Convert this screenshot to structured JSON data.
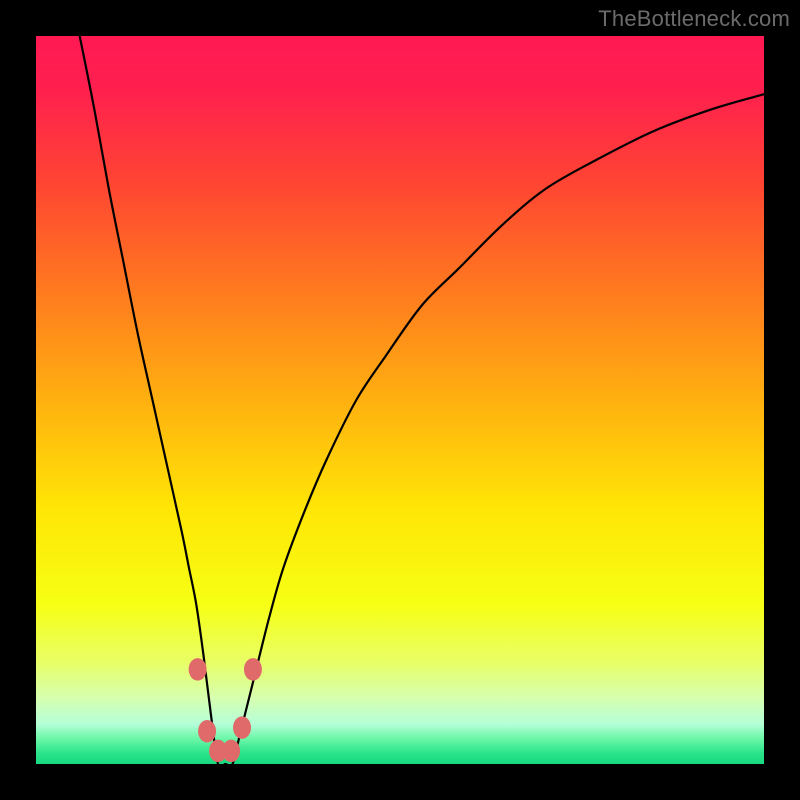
{
  "watermark": "TheBottleneck.com",
  "chart_data": {
    "type": "line",
    "title": "",
    "xlabel": "",
    "ylabel": "",
    "xlim": [
      0,
      100
    ],
    "ylim": [
      0,
      100
    ],
    "background_gradient": {
      "direction": "vertical",
      "stops": [
        {
          "pos": 0.0,
          "color": "#ff1a53"
        },
        {
          "pos": 0.07,
          "color": "#ff1f4f"
        },
        {
          "pos": 0.2,
          "color": "#ff4433"
        },
        {
          "pos": 0.35,
          "color": "#ff7a1f"
        },
        {
          "pos": 0.5,
          "color": "#ffb010"
        },
        {
          "pos": 0.65,
          "color": "#ffe605"
        },
        {
          "pos": 0.78,
          "color": "#f6ff14"
        },
        {
          "pos": 0.86,
          "color": "#e8ff66"
        },
        {
          "pos": 0.91,
          "color": "#d6ffb0"
        },
        {
          "pos": 0.945,
          "color": "#b5ffd8"
        },
        {
          "pos": 0.965,
          "color": "#6cf7a8"
        },
        {
          "pos": 0.985,
          "color": "#2be48b"
        },
        {
          "pos": 1.0,
          "color": "#17d97f"
        }
      ]
    },
    "series": [
      {
        "name": "bottleneck-curve",
        "color": "#000000",
        "x": [
          6,
          8,
          10,
          12,
          14,
          16,
          18,
          20,
          21,
          22,
          23,
          24,
          25,
          26,
          27,
          28,
          30,
          32,
          34,
          37,
          40,
          44,
          48,
          53,
          58,
          64,
          70,
          77,
          85,
          93,
          100
        ],
        "y": [
          100,
          90,
          79,
          69,
          59,
          50,
          41,
          32,
          27,
          22,
          15,
          7,
          0,
          0,
          0,
          4,
          12,
          20,
          27,
          35,
          42,
          50,
          56,
          63,
          68,
          74,
          79,
          83,
          87,
          90,
          92
        ]
      }
    ],
    "markers": {
      "name": "highlight-nodes",
      "color": "#e06a6a",
      "points": [
        {
          "x": 22.2,
          "y": 13.0
        },
        {
          "x": 23.5,
          "y": 4.5
        },
        {
          "x": 25.0,
          "y": 1.8
        },
        {
          "x": 26.8,
          "y": 1.8
        },
        {
          "x": 28.3,
          "y": 5.0
        },
        {
          "x": 29.8,
          "y": 13.0
        }
      ],
      "radius": 9
    }
  }
}
